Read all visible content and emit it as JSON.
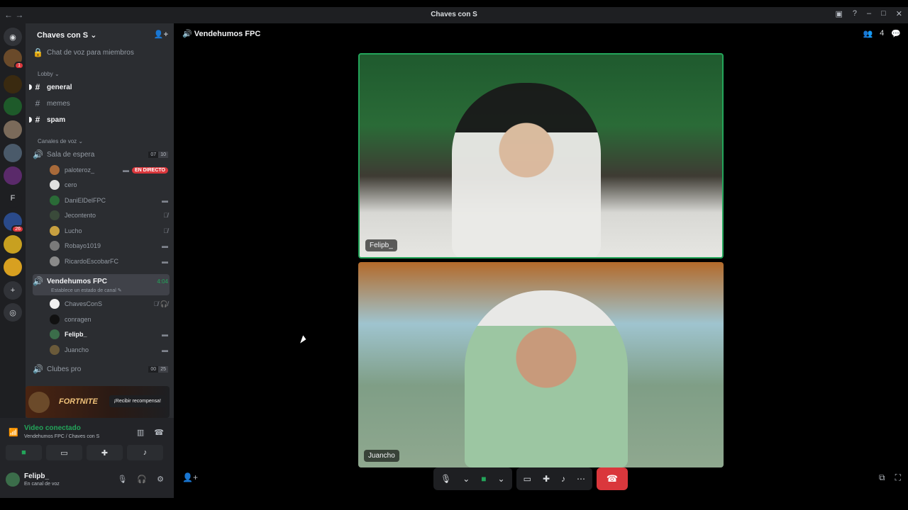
{
  "window": {
    "title": "Chaves con S",
    "nav": "← →"
  },
  "server": {
    "name": "Chaves con S ⌄"
  },
  "channels": {
    "locked_voice": "Chat de voz para miembros",
    "lobby_label": "Lobby ⌄",
    "general": "general",
    "memes": "memes",
    "spam": "spam",
    "voice_label": "Canales de voz ⌄",
    "sala": {
      "name": "Sala de espera",
      "count_a": "07",
      "count_b": "10"
    },
    "sala_users": [
      {
        "name": "paloteroz_",
        "right": "EN DIRECTO"
      },
      {
        "name": "cero",
        "right": ""
      },
      {
        "name": "DaniElDelFPC",
        "right": "▬"
      },
      {
        "name": "Jecontento",
        "right": "🎙̸"
      },
      {
        "name": "Lucho",
        "right": "🎙̸"
      },
      {
        "name": "Robayo1019",
        "right": "▬"
      },
      {
        "name": "RicardoEscobarFC",
        "right": "▬"
      }
    ],
    "vendehumos": {
      "name": "Vendehumos FPC",
      "timer": "4:04",
      "status": "Establece un estado de canal ✎"
    },
    "vendehumos_users": [
      {
        "name": "ChavesConS",
        "right": "🎙̸ 🎧̸"
      },
      {
        "name": "conragen",
        "right": ""
      },
      {
        "name": "Felipb_",
        "right": "▬"
      },
      {
        "name": "Juancho",
        "right": "▬"
      }
    ],
    "clubes": {
      "name": "Clubes pro",
      "count_a": "00",
      "count_b": "25"
    }
  },
  "promo": {
    "brand": "FORTNITE",
    "button": "¡Recibir recompensa!"
  },
  "voice_panel": {
    "status": "Video conectado",
    "sub": "Vendehumos FPC / Chaves con S"
  },
  "user_panel": {
    "name": "Felipb_",
    "status": "En canal de voz"
  },
  "stage": {
    "title": "Vendehumos FPC",
    "participants_count": "4",
    "tiles": [
      {
        "label": "Felipb_"
      },
      {
        "label": "Juancho"
      }
    ]
  },
  "icons": {
    "guild_letter": "F"
  },
  "colors": {
    "accent_green": "#23a55a",
    "danger_red": "#da373c",
    "bg_dark": "#1e1f22",
    "bg_sidebar": "#2b2d31"
  }
}
